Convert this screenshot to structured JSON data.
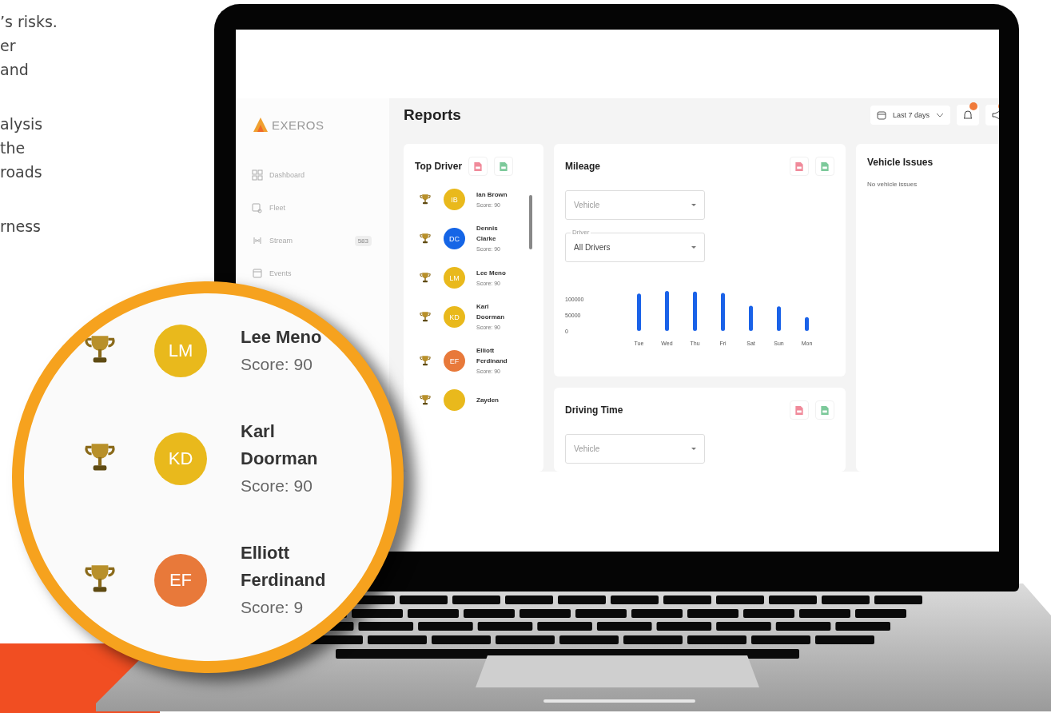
{
  "intro": {
    "paragraphs": [
      [
        "’s risks.",
        "er",
        "and"
      ],
      [
        "alysis",
        "the",
        "roads"
      ],
      [
        "rness"
      ]
    ]
  },
  "app": {
    "logo": "EXEROS",
    "sidebar": {
      "items": [
        {
          "label": "Dashboard"
        },
        {
          "label": "Fleet"
        },
        {
          "label": "Stream",
          "badge": "583"
        },
        {
          "label": "Events"
        }
      ]
    },
    "header": {
      "title": "Reports",
      "date_range": "Last 7 days"
    },
    "top_driver": {
      "title": "Top Driver",
      "drivers": [
        {
          "initials": "IB",
          "name": "Ian Brown",
          "score": "Score: 90",
          "color": "#e9b91c"
        },
        {
          "initials": "DC",
          "name": "Dennis Clarke",
          "score": "Score: 90",
          "color": "#1565e6"
        },
        {
          "initials": "LM",
          "name": "Lee Meno",
          "score": "Score: 90",
          "color": "#e9b91c"
        },
        {
          "initials": "KD",
          "name": "Karl Doorman",
          "score": "Score: 90",
          "color": "#e9b91c"
        },
        {
          "initials": "EF",
          "name": "Elliott Ferdinand",
          "score": "Score: 90",
          "color": "#e8793a"
        },
        {
          "name": "Zayden",
          "color": "#e9b91c"
        }
      ]
    },
    "mileage": {
      "title": "Mileage",
      "vehicle_select": {
        "placeholder": "Vehicle"
      },
      "driver_select": {
        "label": "Driver",
        "value": "All Drivers"
      },
      "chart_data": {
        "type": "bar",
        "categories": [
          "Tue",
          "Wed",
          "Thu",
          "Fri",
          "Sat",
          "Sun",
          "Mon"
        ],
        "values": [
          117000,
          125000,
          123000,
          119000,
          79000,
          77000,
          43000
        ],
        "yticks": [
          0,
          50000,
          100000
        ],
        "ylim": [
          0,
          125000
        ]
      }
    },
    "vehicle_issues": {
      "title": "Vehicle Issues",
      "message": "No vehicle issues"
    },
    "driving_time": {
      "title": "Driving Time",
      "vehicle_select": {
        "placeholder": "Vehicle"
      }
    }
  },
  "magnifier": {
    "drivers": [
      {
        "initials": "LM",
        "name": "Lee Meno",
        "score": "Score: 90",
        "color": "#e9b91c"
      },
      {
        "initials": "KD",
        "name": "Karl Doorman",
        "score": "Score: 90",
        "color": "#e9b91c"
      },
      {
        "initials": "EF",
        "name": "Elliott Ferdinand",
        "score": "Score: 9",
        "color": "#e8793a"
      }
    ]
  }
}
